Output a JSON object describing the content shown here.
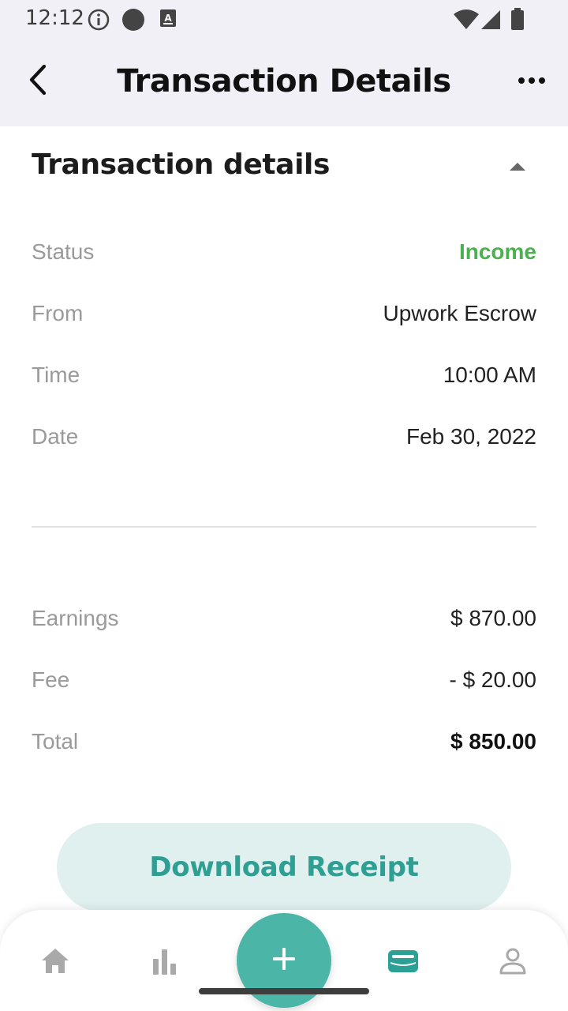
{
  "status_bar": {
    "time": "12:12",
    "icons": [
      "info-icon",
      "circle-icon",
      "keyboard-a-icon",
      "wifi-icon",
      "signal-icon",
      "battery-icon"
    ]
  },
  "header": {
    "title": "Transaction Details",
    "back_icon": "chevron-left-icon",
    "more_icon": "more-horizontal-icon"
  },
  "section": {
    "title": "Transaction details",
    "toggle_icon": "caret-up-icon"
  },
  "details": [
    {
      "label": "Status",
      "value": "Income"
    },
    {
      "label": "From",
      "value": "Upwork Escrow"
    },
    {
      "label": "Time",
      "value": "10:00 AM"
    },
    {
      "label": "Date",
      "value": "Feb 30, 2022"
    }
  ],
  "summary": [
    {
      "label": "Earnings",
      "value": "$ 870.00"
    },
    {
      "label": "Fee",
      "value": "- $ 20.00"
    },
    {
      "label": "Total",
      "value": "$ 850.00"
    }
  ],
  "actions": {
    "download_label": "Download Receipt"
  },
  "bottom_nav": {
    "items": [
      "home-icon",
      "stats-icon",
      "add-icon",
      "wallet-icon",
      "profile-icon"
    ],
    "active": "wallet-icon"
  },
  "colors": {
    "income": "#4caf50",
    "accent": "#4bb5a8",
    "button_bg": "#dff0ef",
    "button_text": "#2f9e93",
    "header_bg": "#f1f0f6",
    "muted_label": "#9a9a9a"
  }
}
